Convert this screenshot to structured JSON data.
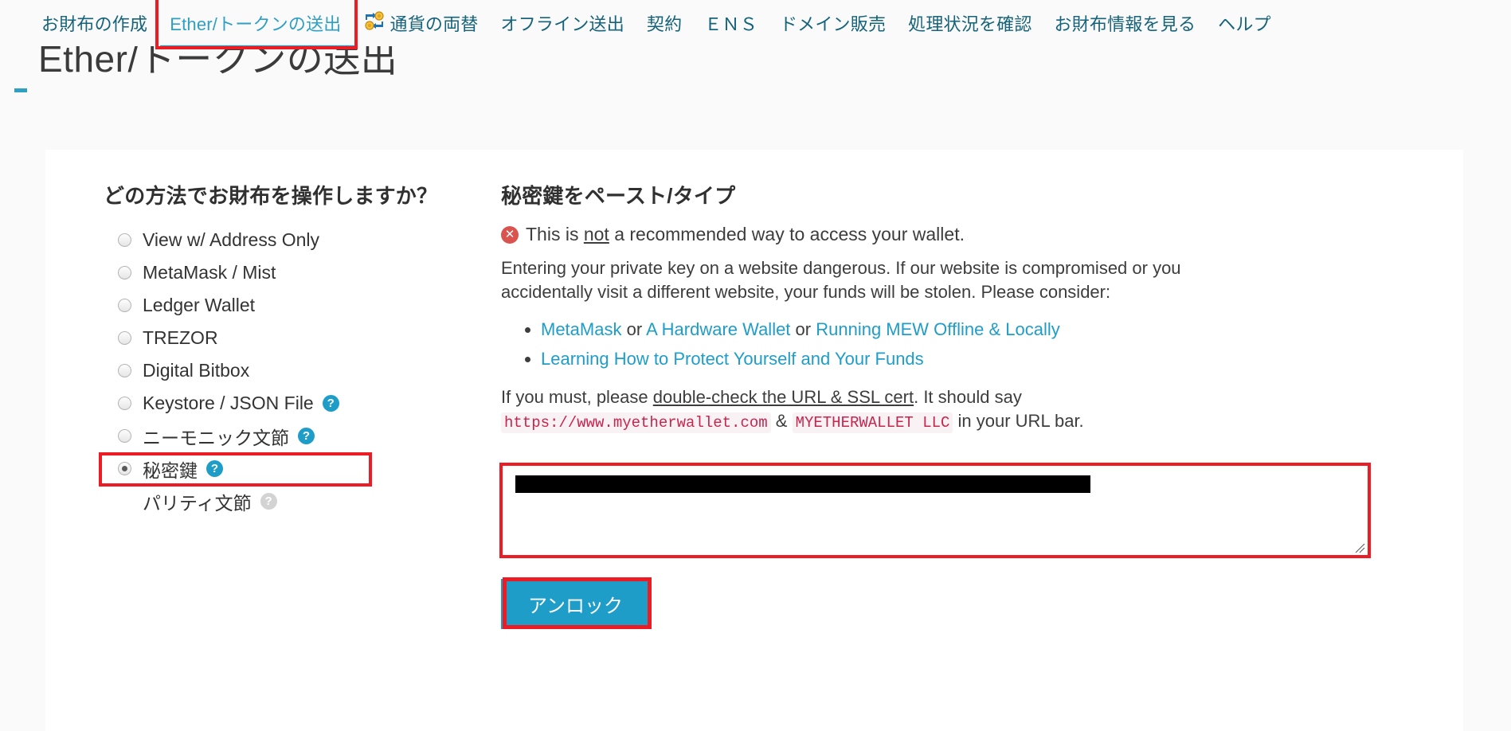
{
  "nav": {
    "items": [
      {
        "label": "お財布の作成",
        "active": false,
        "icon": null
      },
      {
        "label": "Ether/トークンの送出",
        "active": true,
        "icon": null
      },
      {
        "label": "通貨の両替",
        "active": false,
        "icon": "currency-exchange-icon"
      },
      {
        "label": "オフライン送出",
        "active": false,
        "icon": null
      },
      {
        "label": "契約",
        "active": false,
        "icon": null
      },
      {
        "label": "ＥＮＳ",
        "active": false,
        "icon": null
      },
      {
        "label": "ドメイン販売",
        "active": false,
        "icon": null
      },
      {
        "label": "処理状況を確認",
        "active": false,
        "icon": null
      },
      {
        "label": "お財布情報を見る",
        "active": false,
        "icon": null
      },
      {
        "label": "ヘルプ",
        "active": false,
        "icon": null
      }
    ]
  },
  "page": {
    "title": "Ether/トークンの送出"
  },
  "left": {
    "heading": "どの方法でお財布を操作しますか？",
    "options": [
      {
        "label": "View w/ Address Only",
        "checked": false,
        "help": false,
        "help_muted": false,
        "radio_hidden": false,
        "highlight": false
      },
      {
        "label": "MetaMask / Mist",
        "checked": false,
        "help": false,
        "help_muted": false,
        "radio_hidden": false,
        "highlight": false
      },
      {
        "label": "Ledger Wallet",
        "checked": false,
        "help": false,
        "help_muted": false,
        "radio_hidden": false,
        "highlight": false
      },
      {
        "label": "TREZOR",
        "checked": false,
        "help": false,
        "help_muted": false,
        "radio_hidden": false,
        "highlight": false
      },
      {
        "label": "Digital Bitbox",
        "checked": false,
        "help": false,
        "help_muted": false,
        "radio_hidden": false,
        "highlight": false
      },
      {
        "label": "Keystore / JSON File",
        "checked": false,
        "help": true,
        "help_muted": false,
        "radio_hidden": false,
        "highlight": false
      },
      {
        "label": "ニーモニック文節",
        "checked": false,
        "help": true,
        "help_muted": false,
        "radio_hidden": false,
        "highlight": false
      },
      {
        "label": "秘密鍵",
        "checked": true,
        "help": true,
        "help_muted": false,
        "radio_hidden": false,
        "highlight": true
      },
      {
        "label": "パリティ文節",
        "checked": false,
        "help": true,
        "help_muted": true,
        "radio_hidden": true,
        "highlight": false
      }
    ],
    "help_glyph": "?"
  },
  "right": {
    "heading": "秘密鍵をペースト/タイプ",
    "danger_icon_glyph": "✕",
    "danger_prefix": "This is ",
    "danger_underlined": "not",
    "danger_suffix": " a recommended way to access your wallet.",
    "paragraph": "Entering your private key on a website dangerous. If our website is compromised or you accidentally visit a different website, your funds will be stolen. Please consider:",
    "bullet1": {
      "link1": "MetaMask",
      "sep1": " or ",
      "link2": "A Hardware Wallet",
      "sep2": " or ",
      "link3": "Running MEW Offline & Locally"
    },
    "bullet2": {
      "link1": "Learning How to Protect Yourself and Your Funds"
    },
    "ssl": {
      "prefix": "If you must, please ",
      "underlined": "double-check the URL & SSL cert",
      "middle": ". It should say ",
      "code1": "https://www.myetherwallet.com",
      "amp": " & ",
      "code2": "MYETHERWALLET LLC",
      "suffix": " in your URL bar."
    },
    "private_key_field": {
      "value": "",
      "placeholder": ""
    },
    "unlock_label": "アンロック"
  },
  "colors": {
    "nav_link": "#16637b",
    "nav_active": "#2f9fc4",
    "accent_teal": "#1f9dc9",
    "highlight_red": "#ed1c24",
    "danger_red": "#d9534f",
    "code_text": "#c7254e",
    "code_bg": "#f9f2f4",
    "page_bg": "#fafafa",
    "panel_bg": "#ffffff",
    "textarea_border": "#b9dfb9"
  }
}
